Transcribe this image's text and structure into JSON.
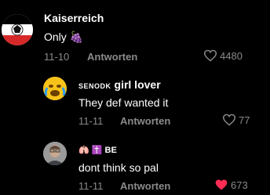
{
  "comments": [
    {
      "username": "Kaiserreich",
      "text": "Only 🍇",
      "date": "11-10",
      "reply_label": "Antworten",
      "likes": "4480",
      "liked": false
    },
    {
      "username_prefix": "SENODK",
      "username": "girl lover",
      "text": "They def wanted it",
      "date": "11-11",
      "reply_label": "Antworten",
      "likes": "77",
      "liked": false
    },
    {
      "username_badges": "🫁 ✝️ BE",
      "text": "dont think so pal",
      "date": "11-11",
      "reply_label": "Antworten",
      "likes": "673",
      "liked": true
    }
  ],
  "colors": {
    "background": "#000000",
    "muted": "#8a8a8a",
    "liked_heart": "#fe2c55"
  }
}
